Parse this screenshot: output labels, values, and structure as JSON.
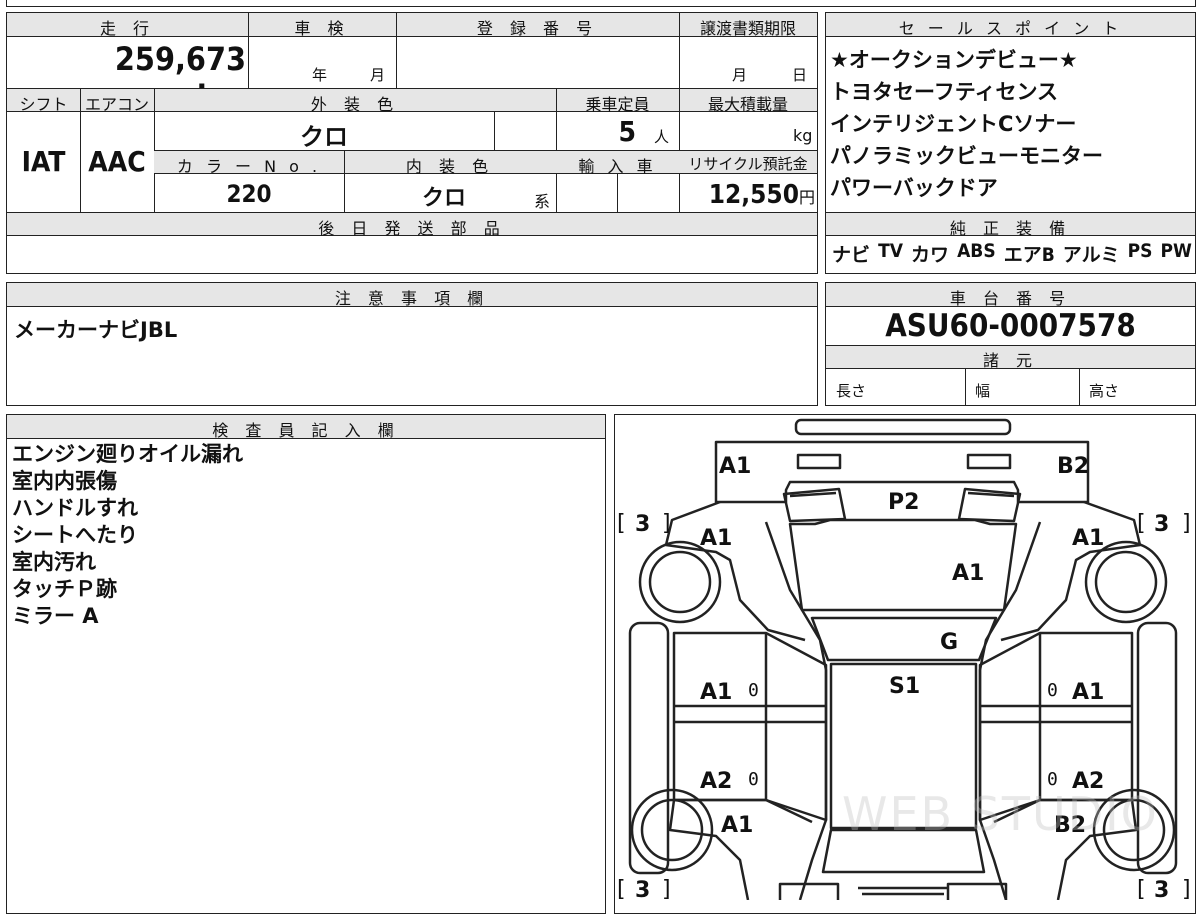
{
  "header": {
    "mileage_label": "走 行",
    "shaken_label": "車 検",
    "registration_label": "登 録 番 号",
    "transfer_deadline_label": "譲渡書類期限",
    "sales_points_label": "セ ー ル ス ポ イ ン ト"
  },
  "mileage": {
    "value": "259,673",
    "unit": "km"
  },
  "shaken": {
    "year_unit": "年",
    "month_unit": "月"
  },
  "deadline": {
    "month_unit": "月",
    "day_unit": "日"
  },
  "row2": {
    "shift_label": "シフト",
    "ac_label": "エアコン",
    "exterior_color_label": "外 装 色",
    "capacity_label": "乗車定員",
    "max_load_label": "最大積載量",
    "shift": "IAT",
    "ac": "AAC",
    "exterior_color": "クロ",
    "capacity": "5",
    "capacity_unit": "人",
    "load_unit": "kg"
  },
  "row3": {
    "color_no_label": "カ ラ ー N o .",
    "interior_color_label": "内 装 色",
    "import_label": "輸 入 車",
    "recycle_label": "リサイクル預託金",
    "color_no": "220",
    "interior_color": "クロ",
    "interior_suffix": "系",
    "recycle_fee": "12,550",
    "recycle_unit": "円"
  },
  "later_parts_label": "後 日 発 送 部 品",
  "sales_points": [
    "★オークションデビュー★",
    "トヨタセーフティセンス",
    "インテリジェントCソナー",
    "パノラミックビューモニター",
    "パワーバックドア"
  ],
  "standard_equipment_label": "純 正 装 備",
  "standard_equipment": [
    "ナビ",
    "TV",
    "カワ",
    "ABS",
    "エアB",
    "アルミ",
    "PS",
    "PW"
  ],
  "notes_label": "注 意 事 項 欄",
  "notes_text": "メーカーナビJBL",
  "chassis_label": "車 台 番 号",
  "chassis_number": "ASU60-0007578",
  "specs_label": "諸 元",
  "specs": {
    "length": "長さ",
    "width": "幅",
    "height": "高さ"
  },
  "inspector_label": "検 査 員 記 入 欄",
  "inspector_notes": [
    "エンジン廻りオイル漏れ",
    "室内内張傷",
    "ハンドルすれ",
    "シートへたり",
    "室内汚れ",
    "タッチＰ跡",
    "ミラー A"
  ],
  "diagram": {
    "marks": {
      "front_left": "A1",
      "front_right": "B2",
      "hood_center": "P2",
      "hood": "A1",
      "left_fender": "A1",
      "right_fender": "A1",
      "windshield": "G",
      "roof": "S1",
      "left_front_door": "A1",
      "right_front_door": "A1",
      "left_rear_door": "A2",
      "right_rear_door": "A2",
      "left_quarter": "A1",
      "right_quarter": "B2",
      "zero": "0",
      "tire_tread": "3"
    },
    "bracket_open": "[",
    "bracket_close": "]"
  },
  "watermark": "WEB STUDIO"
}
